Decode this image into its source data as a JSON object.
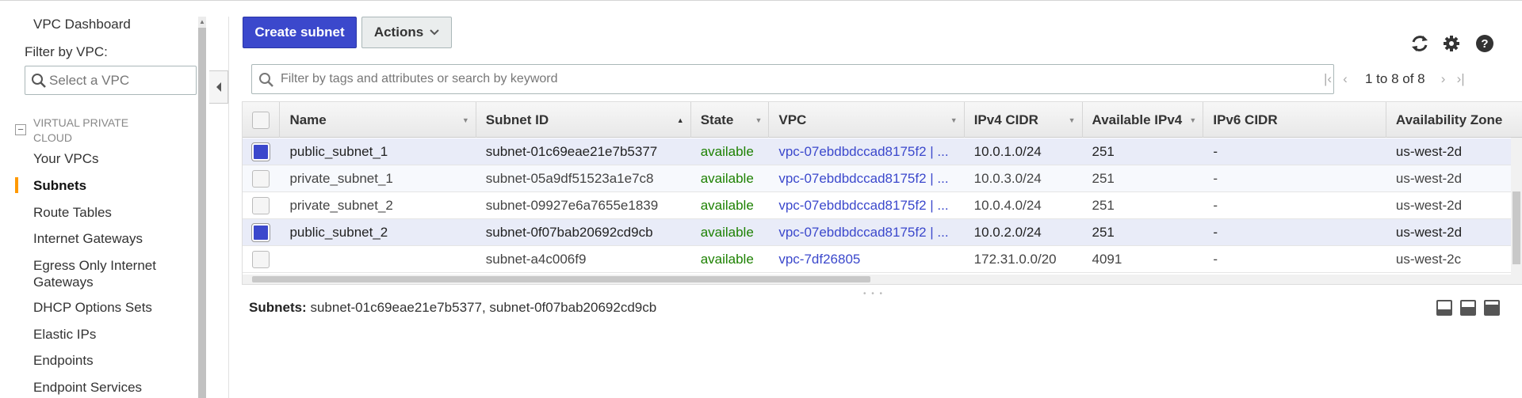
{
  "sidebar": {
    "dashboard": "VPC Dashboard",
    "filter_label": "Filter by VPC:",
    "filter_placeholder": "Select a VPC",
    "section_title": "VIRTUAL PRIVATE CLOUD",
    "items": [
      {
        "label": "Your VPCs"
      },
      {
        "label": "Subnets"
      },
      {
        "label": "Route Tables"
      },
      {
        "label": "Internet Gateways"
      },
      {
        "label": "Egress Only Internet Gateways"
      },
      {
        "label": "DHCP Options Sets"
      },
      {
        "label": "Elastic IPs"
      },
      {
        "label": "Endpoints"
      },
      {
        "label": "Endpoint Services"
      }
    ],
    "active_item": "Subnets"
  },
  "toolbar": {
    "create_label": "Create subnet",
    "actions_label": "Actions",
    "icons": [
      "refresh-icon",
      "gear-icon",
      "help-icon"
    ]
  },
  "search": {
    "placeholder": "Filter by tags and attributes or search by keyword"
  },
  "pager": {
    "text": "1 to 8 of 8"
  },
  "table": {
    "headers": {
      "name": "Name",
      "subnet_id": "Subnet ID",
      "state": "State",
      "vpc": "VPC",
      "ipv4": "IPv4 CIDR",
      "avail_ipv4": "Available IPv4",
      "ipv6": "IPv6 CIDR",
      "az": "Availability Zone"
    },
    "rows": [
      {
        "checked": true,
        "name": "public_subnet_1",
        "subnet_id": "subnet-01c69eae21e7b5377",
        "state": "available",
        "vpc": "vpc-07ebdbdccad8175f2 | ...",
        "ipv4": "10.0.1.0/24",
        "avail": "251",
        "ipv6": "-",
        "az": "us-west-2d"
      },
      {
        "checked": false,
        "name": "private_subnet_1",
        "subnet_id": "subnet-05a9df51523a1e7c8",
        "state": "available",
        "vpc": "vpc-07ebdbdccad8175f2 | ...",
        "ipv4": "10.0.3.0/24",
        "avail": "251",
        "ipv6": "-",
        "az": "us-west-2d"
      },
      {
        "checked": false,
        "name": "private_subnet_2",
        "subnet_id": "subnet-09927e6a7655e1839",
        "state": "available",
        "vpc": "vpc-07ebdbdccad8175f2 | ...",
        "ipv4": "10.0.4.0/24",
        "avail": "251",
        "ipv6": "-",
        "az": "us-west-2d"
      },
      {
        "checked": true,
        "name": "public_subnet_2",
        "subnet_id": "subnet-0f07bab20692cd9cb",
        "state": "available",
        "vpc": "vpc-07ebdbdccad8175f2 | ...",
        "ipv4": "10.0.2.0/24",
        "avail": "251",
        "ipv6": "-",
        "az": "us-west-2d"
      },
      {
        "checked": false,
        "name": "",
        "subnet_id": "subnet-a4c006f9",
        "state": "available",
        "vpc": "vpc-7df26805",
        "ipv4": "172.31.0.0/20",
        "avail": "4091",
        "ipv6": "-",
        "az": "us-west-2c"
      }
    ]
  },
  "details": {
    "label": "Subnets:",
    "value": "subnet-01c69eae21e7b5377, subnet-0f07bab20692cd9cb"
  },
  "colors": {
    "primary": "#3b48cc",
    "available": "#1d8102",
    "active_marker": "#ff9900"
  }
}
